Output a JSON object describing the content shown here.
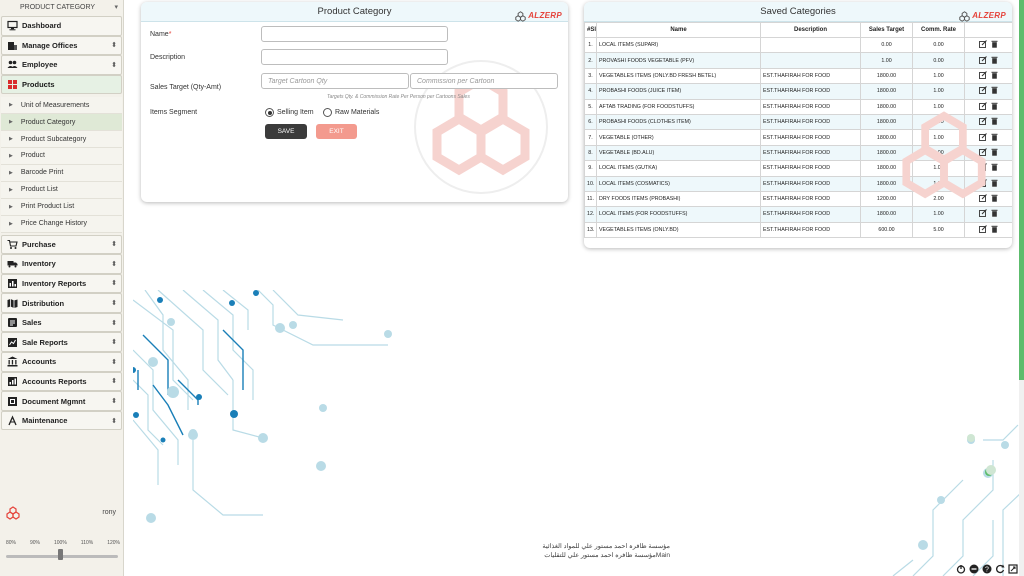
{
  "sidebar": {
    "header": "PRODUCT CATEGORY",
    "menu_top": [
      {
        "label": "Dashboard",
        "icon": "monitor-icon",
        "arrow": ""
      },
      {
        "label": "Manage Offices",
        "icon": "office-icon",
        "arrow": "⬍"
      },
      {
        "label": "Employee",
        "icon": "users-icon",
        "arrow": "⬍"
      },
      {
        "label": "Products",
        "icon": "grid-icon",
        "arrow": ""
      }
    ],
    "submenu": [
      "Unit of Measurements",
      "Product Category",
      "Product Subcategory",
      "Product",
      "Barcode Print",
      "Product List",
      "Print Product List",
      "Price Change History"
    ],
    "menu_bottom": [
      {
        "label": "Purchase",
        "icon": "cart-icon"
      },
      {
        "label": "Inventory",
        "icon": "truck-icon"
      },
      {
        "label": "Inventory Reports",
        "icon": "report-icon"
      },
      {
        "label": "Distribution",
        "icon": "map-icon"
      },
      {
        "label": "Sales",
        "icon": "sales-icon"
      },
      {
        "label": "Sale Reports",
        "icon": "sale-report-icon"
      },
      {
        "label": "Accounts",
        "icon": "bank-icon"
      },
      {
        "label": "Accounts Reports",
        "icon": "chart-icon"
      },
      {
        "label": "Document Mgmnt",
        "icon": "document-icon"
      },
      {
        "label": "Maintenance",
        "icon": "tools-icon"
      }
    ],
    "user": "rony",
    "zoom_levels": [
      "80%",
      "90%",
      "100%",
      "110%",
      "120%"
    ],
    "zoom_value": "100%"
  },
  "form": {
    "title": "Product Category",
    "logo_text": "ALZERP",
    "name_label": "Name",
    "required_mark": "*",
    "description_label": "Description",
    "sales_target_label": "Sales Target (Qty-Amt)",
    "target_placeholder": "Target Cartoon Qty",
    "commission_placeholder": "Commission per Cartoon",
    "hint": "Targets Qty. & Commission Rate Per Person per Cartoons Sales",
    "segment_label": "Items Segment",
    "segment_options": [
      "Selling Item",
      "Raw Materials"
    ],
    "save_label": "SAVE",
    "exit_label": "EXIT"
  },
  "table": {
    "title": "Saved Categories",
    "logo_text": "ALZERP",
    "columns": [
      "#Sl",
      "Name",
      "Description",
      "Sales Target",
      "Comm. Rate",
      ""
    ],
    "rows": [
      [
        "1.",
        "LOCAL ITEMS (SUPARI)",
        "",
        "0.00",
        "0.00"
      ],
      [
        "2.",
        "PROVASHI FOODS VEGETABLE (PFV)",
        "",
        "1.00",
        "0.00"
      ],
      [
        "3.",
        "VEGETABLES ITEMS (ONLY.BD FRESH BETEL)",
        "EST.THAFIRAH FOR FOOD",
        "1800.00",
        "1.00"
      ],
      [
        "4.",
        "PROBASHI FOODS (JUICE ITEM)",
        "EST.THAFIRAH FOR FOOD",
        "1800.00",
        "1.00"
      ],
      [
        "5.",
        "AFTAB TRADING (FOR FOODSTUFFS)",
        "EST.THAFIRAH FOR FOOD",
        "1800.00",
        "1.00"
      ],
      [
        "6.",
        "PROBASHI FOODS (CLOTHES ITEM)",
        "EST.THAFIRAH FOR FOOD",
        "1800.00",
        "1.00"
      ],
      [
        "7.",
        "VEGETABLE (OTHER)",
        "EST.THAFIRAH FOR FOOD",
        "1800.00",
        "1.00"
      ],
      [
        "8.",
        "VEGETABLE (BD.ALU)",
        "EST.THAFIRAH FOR FOOD",
        "1800.00",
        "1.00"
      ],
      [
        "9.",
        "LOCAL ITEMS (GUTKA)",
        "EST.THAFIRAH FOR FOOD",
        "1800.00",
        "1.00"
      ],
      [
        "10.",
        "LOCAL ITEMS (COSMATICS)",
        "EST.THAFIRAH FOR FOOD",
        "1800.00",
        "1.00"
      ],
      [
        "11.",
        "DRY FOODS ITEMS (PROBASHI)",
        "EST.THAFIRAH FOR FOOD",
        "1200.00",
        "2.00"
      ],
      [
        "12.",
        "LOCAL ITEMS (FOR FOODSTUFFS)",
        "EST.THAFIRAH FOR FOOD",
        "1800.00",
        "1.00"
      ],
      [
        "13.",
        "VEGETABLES ITEMS (ONLY.BD)",
        "EST.THAFIRAH FOR FOOD",
        "600.00",
        "5.00"
      ]
    ]
  },
  "footer": {
    "line1": "مؤسسة ظافرہ احمد مستور علي للمواد الغذائية",
    "line2": "Mainمؤسسة ظافره احمد مستور علي للتقليات"
  },
  "colors": {
    "accent_green": "#5cbc6c",
    "brand_red": "#e5433b",
    "save": "#3b3b3b",
    "exit": "#f39a8e",
    "circuit_dark": "#1a7fb8",
    "circuit_light": "#b9dbe6"
  }
}
